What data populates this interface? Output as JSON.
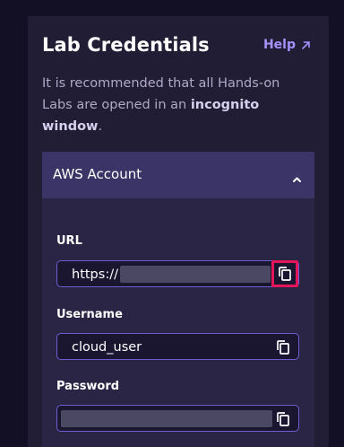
{
  "panel": {
    "title": "Lab Credentials",
    "help_label": "Help",
    "intro": {
      "text_before": "It is recommended that all Hands-on Labs are opened in an ",
      "bold_text": "incognito window",
      "text_after": "."
    }
  },
  "accordion": {
    "title": "AWS Account",
    "expanded": true
  },
  "fields": {
    "url": {
      "label": "URL",
      "value_visible": "https://",
      "value_masked": true
    },
    "username": {
      "label": "Username",
      "value": "cloud_user"
    },
    "password": {
      "label": "Password",
      "value_masked": true
    }
  },
  "icons": {
    "help": "external-arrow-icon",
    "accordion": "chevron-up-icon",
    "copy": "copy-icon"
  },
  "colors": {
    "accent": "#a692ff",
    "highlight": "#e6145a",
    "field_border": "#6b5fd0"
  }
}
